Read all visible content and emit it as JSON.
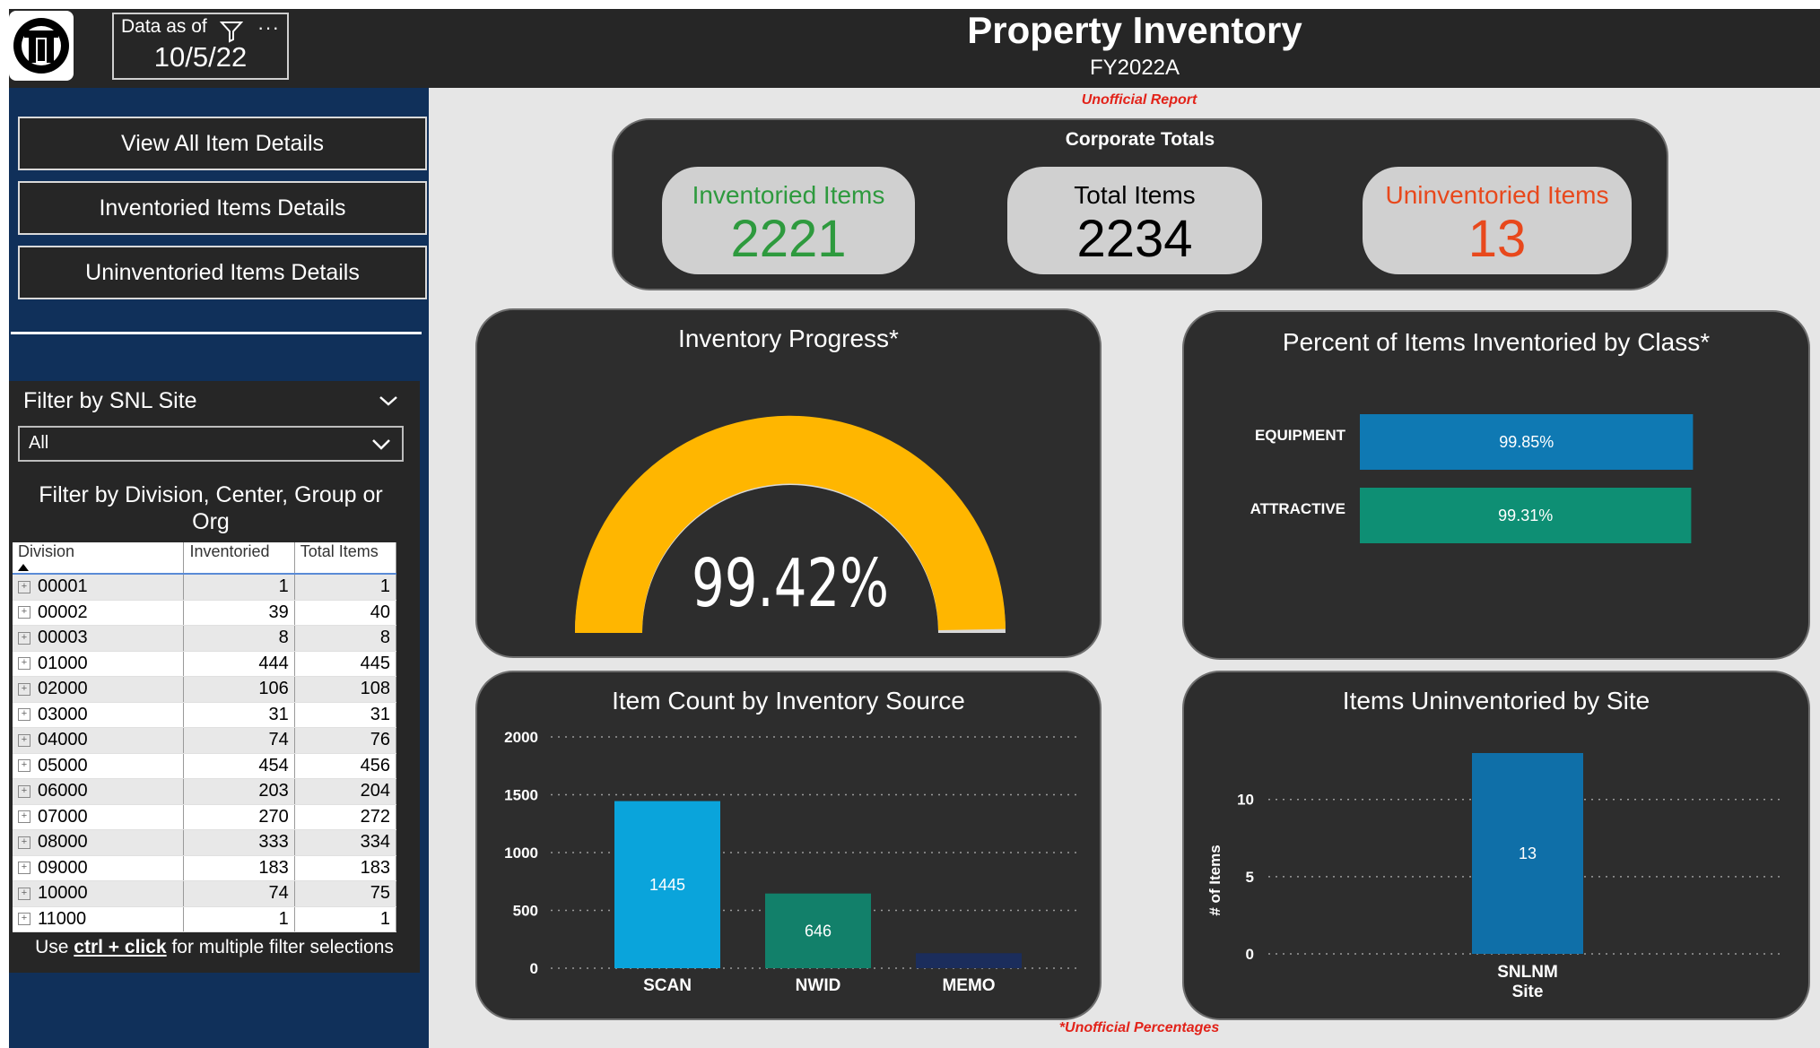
{
  "header": {
    "title": "Property Inventory",
    "subtitle": "FY2022A",
    "date_label": "Data as of",
    "date_value": "10/5/22",
    "more_glyph": "···",
    "icons": [
      "logo-icon",
      "filter-icon",
      "more-options-icon"
    ]
  },
  "notices": {
    "top": "Unofficial Report",
    "bottom": "*Unofficial Percentages"
  },
  "sidebar": {
    "buttons": [
      {
        "label": "View All Item Details"
      },
      {
        "label": "Inventoried Items Details"
      },
      {
        "label": "Uninventoried Items Details"
      }
    ],
    "site_filter": {
      "title": "Filter by SNL Site",
      "selected": "All"
    },
    "org_filter": {
      "title": "Filter by Division, Center, Group or Org",
      "columns": [
        "Division",
        "Inventoried",
        "Total Items"
      ],
      "rows": [
        [
          "00001",
          "1",
          "1"
        ],
        [
          "00002",
          "39",
          "40"
        ],
        [
          "00003",
          "8",
          "8"
        ],
        [
          "01000",
          "444",
          "445"
        ],
        [
          "02000",
          "106",
          "108"
        ],
        [
          "03000",
          "31",
          "31"
        ],
        [
          "04000",
          "74",
          "76"
        ],
        [
          "05000",
          "454",
          "456"
        ],
        [
          "06000",
          "203",
          "204"
        ],
        [
          "07000",
          "270",
          "272"
        ],
        [
          "08000",
          "333",
          "334"
        ],
        [
          "09000",
          "183",
          "183"
        ],
        [
          "10000",
          "74",
          "75"
        ],
        [
          "11000",
          "1",
          "1"
        ]
      ]
    },
    "hint": {
      "before": "Use ",
      "bold": "ctrl + click",
      "after": " for multiple filter selections"
    }
  },
  "corporate_totals": {
    "title": "Corporate Totals",
    "inventoried": {
      "label": "Inventoried Items",
      "value": "2221",
      "color": "#2e9a3e"
    },
    "total": {
      "label": "Total Items",
      "value": "2234",
      "color": "#000000"
    },
    "uninventoried": {
      "label": "Uninventoried Items",
      "value": "13",
      "color": "#e8481c"
    }
  },
  "gauge": {
    "title": "Inventory Progress*",
    "value_label": "99.42%",
    "value": 0.9942,
    "color": "#ffb600"
  },
  "class_chart": {
    "title": "Percent of Items Inventoried by Class*",
    "rows": [
      {
        "label": "EQUIPMENT",
        "value_label": "99.85%",
        "value": 99.85,
        "color": "#0f79b3"
      },
      {
        "label": "ATTRACTIVE",
        "value_label": "99.31%",
        "value": 99.31,
        "color": "#0e8f74"
      }
    ]
  },
  "chart_data": [
    {
      "type": "bar",
      "title": "Item Count by Inventory Source",
      "categories": [
        "SCAN",
        "NWID",
        "MEMO"
      ],
      "values": [
        1445,
        646,
        130
      ],
      "data_labels": [
        "1445",
        "646",
        ""
      ],
      "colors": [
        "#0aa4db",
        "#12806a",
        "#1b2d5c"
      ],
      "ylim": [
        0,
        2000
      ],
      "yticks": [
        0,
        500,
        1000,
        1500,
        2000
      ],
      "grid": true
    },
    {
      "type": "bar",
      "title": "Items Uninventoried by Site",
      "categories": [
        "SNLNM"
      ],
      "values": [
        13
      ],
      "data_labels": [
        "13"
      ],
      "colors": [
        "#0f6fa8"
      ],
      "xlabel": "Site",
      "ylabel": "# of Items",
      "ylim": [
        0,
        13
      ],
      "yticks": [
        0,
        5,
        10
      ],
      "grid": true
    }
  ]
}
